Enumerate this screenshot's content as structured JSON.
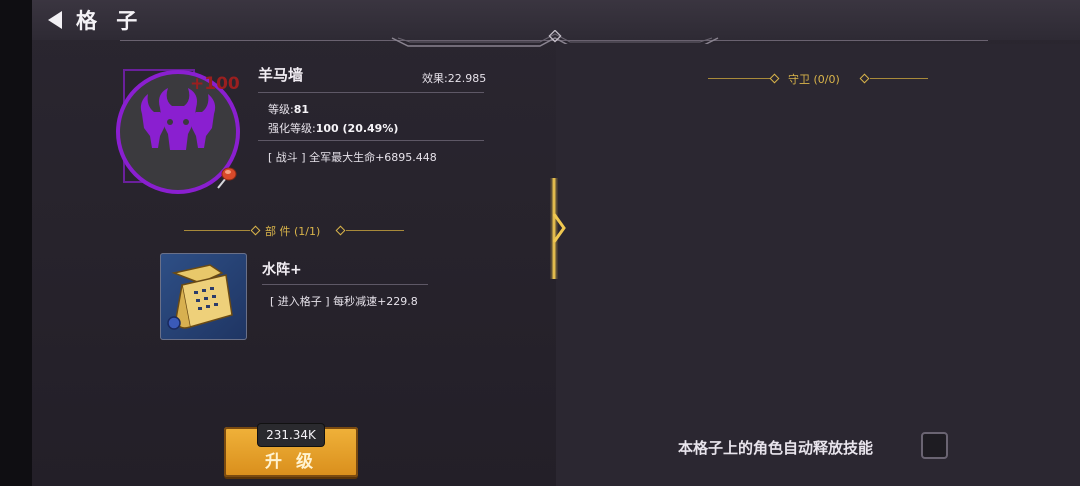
{
  "header": {
    "title": "格 子"
  },
  "item": {
    "name": "羊马墙",
    "effect_label": "效果:22.985",
    "badge": "+100",
    "level_label": "等级:",
    "level_value": "81",
    "enhance_label": "强化等级:",
    "enhance_value": "100 (20.49%)",
    "battle_desc": "[ 战斗 ] 全军最大生命+6895.448"
  },
  "parts": {
    "section_title": "部 件 (1/1)",
    "items": [
      {
        "name": "水阵+",
        "desc": "[ 进入格子 ] 每秒减速+229.8"
      }
    ]
  },
  "guard": {
    "section_title": "守卫 (0/0)"
  },
  "upgrade": {
    "cost": "231.34K",
    "label": "升 级"
  },
  "auto_skill": {
    "label": "本格子上的角色自动释放技能",
    "checked": false
  },
  "colors": {
    "accent_gold": "#d9b44a",
    "emblem_purple": "#8a1fd0",
    "button_orange": "#e5a02a"
  },
  "icons": [
    "back-arrow-icon",
    "bull-skull-emblem-icon",
    "pushpin-icon",
    "scroll-item-icon"
  ]
}
